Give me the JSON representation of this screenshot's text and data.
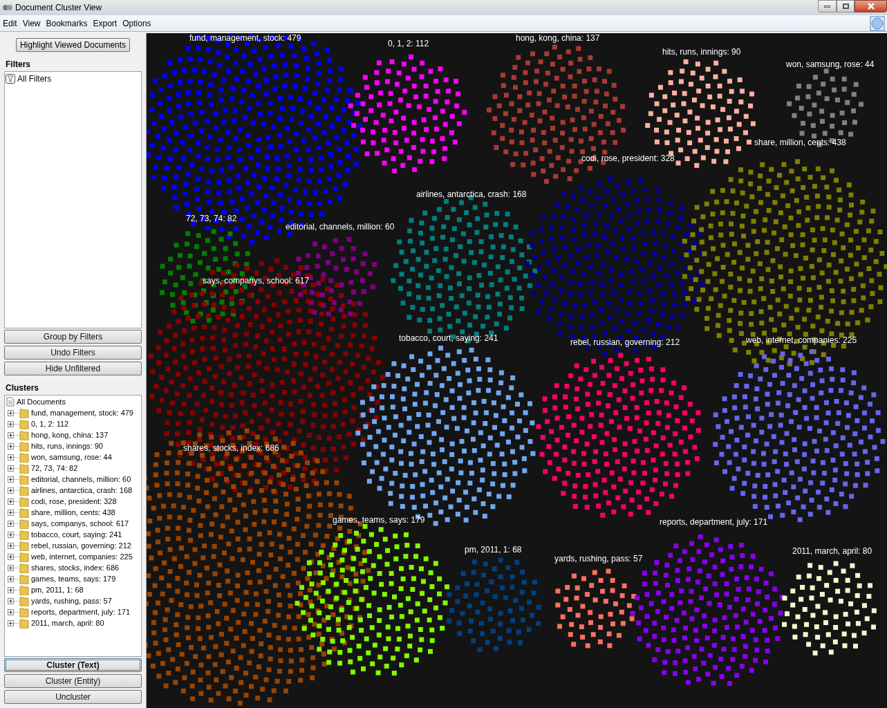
{
  "window": {
    "title": "Document Cluster View"
  },
  "menu": [
    "Edit",
    "View",
    "Bookmarks",
    "Export",
    "Options"
  ],
  "highlight_button": "Highlight Viewed Documents",
  "filters": {
    "title": "Filters",
    "items": [
      {
        "label": "All Filters"
      }
    ],
    "buttons": [
      "Group by Filters",
      "Undo Filters",
      "Hide Unfiltered"
    ]
  },
  "clusters_panel": {
    "title": "Clusters",
    "root": {
      "label": "All Documents",
      "children": [
        {
          "label": "fund, management, stock: 479",
          "expanded": false
        },
        {
          "label": "0, 1, 2: 112",
          "expanded": false
        },
        {
          "label": "hong, kong, china: 137",
          "expanded": false
        },
        {
          "label": "hits, runs, innings: 90",
          "expanded": false
        },
        {
          "label": "won, samsung, rose: 44",
          "expanded": false
        },
        {
          "label": "72, 73, 74: 82",
          "expanded": false
        },
        {
          "label": "editorial, channels, million: 60",
          "expanded": false
        },
        {
          "label": "airlines, antarctica, crash: 168",
          "expanded": false
        },
        {
          "label": "codi, rose, president: 328",
          "expanded": false
        },
        {
          "label": "share, million, cents: 438",
          "expanded": false
        },
        {
          "label": "says, companys, school: 617",
          "expanded": false
        },
        {
          "label": "tobacco, court, saying: 241",
          "expanded": false
        },
        {
          "label": "rebel, russian, governing: 212",
          "expanded": false
        },
        {
          "label": "web, internet, companies: 225",
          "expanded": false
        },
        {
          "label": "shares, stocks, index: 686",
          "expanded": false
        },
        {
          "label": "games, teams, says: 179",
          "expanded": false
        },
        {
          "label": "pm, 2011, 1: 68",
          "expanded": false
        },
        {
          "label": "yards, rushing, pass: 57",
          "expanded": false
        },
        {
          "label": "reports, department, july: 171",
          "expanded": false
        },
        {
          "label": "2011, march, april: 80",
          "expanded": false
        }
      ]
    },
    "buttons": [
      {
        "label": "Cluster (Text)",
        "selected": true
      },
      {
        "label": "Cluster (Entity)",
        "selected": false
      },
      {
        "label": "Uncluster",
        "selected": false
      }
    ]
  },
  "canvas": {
    "clusters": [
      {
        "label": "fund, management, stock: 479",
        "color": "#0000ff"
      },
      {
        "label": "0, 1, 2: 112",
        "color": "#ff00ff"
      },
      {
        "label": "hong, kong, china: 137",
        "color": "#a83a32"
      },
      {
        "label": "hits, runs, innings: 90",
        "color": "#ffb0a0"
      },
      {
        "label": "won, samsung, rose: 44",
        "color": "#808080"
      },
      {
        "label": "72, 73, 74: 82",
        "color": "#008000"
      },
      {
        "label": "editorial, channels, million: 60",
        "color": "#800080"
      },
      {
        "label": "airlines, antarctica, crash: 168",
        "color": "#008080"
      },
      {
        "label": "codi, rose, president: 328",
        "color": "#000099"
      },
      {
        "label": "share, million, cents: 438",
        "color": "#808000"
      },
      {
        "label": "says, companys, school: 617",
        "color": "#8b0000"
      },
      {
        "label": "tobacco, court, saying: 241",
        "color": "#70a8f0"
      },
      {
        "label": "rebel, russian, governing: 212",
        "color": "#ff0066"
      },
      {
        "label": "web, internet, companies: 225",
        "color": "#6666ee"
      },
      {
        "label": "shares, stocks, index: 686",
        "color": "#994400"
      },
      {
        "label": "games, teams, says: 179",
        "color": "#80ff00"
      },
      {
        "label": "pm, 2011, 1: 68",
        "color": "#004080"
      },
      {
        "label": "yards, rushing, pass: 57",
        "color": "#ff7060"
      },
      {
        "label": "reports, department, july: 171",
        "color": "#8800ee"
      },
      {
        "label": "2011, march, april: 80",
        "color": "#eeffcc"
      }
    ]
  }
}
